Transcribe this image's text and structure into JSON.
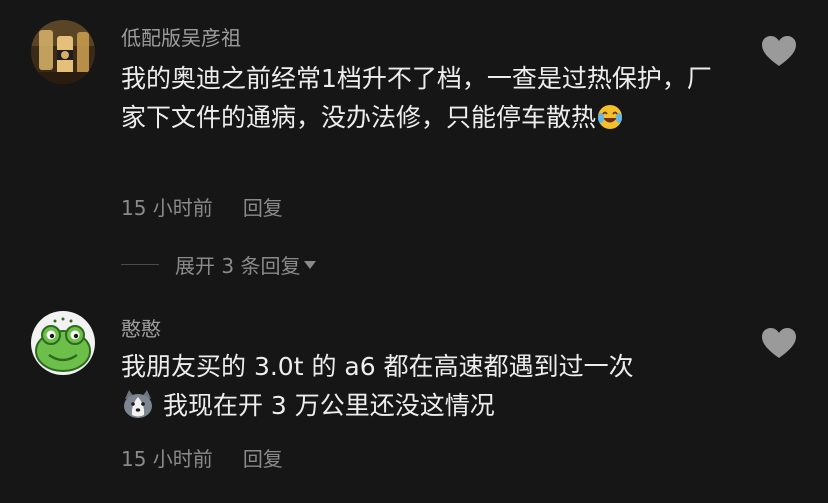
{
  "comments": [
    {
      "username": "低配版吴彦祖",
      "text": "我的奥迪之前经常1档升不了档，一查是过热保护，厂家下文件的通病，没办法修，只能停车散热",
      "time": "15 小时前",
      "reply_label": "回复",
      "avatar_icon": "milk-tea-avatar",
      "trailing_emoji": "laughing-crying-emoji"
    },
    {
      "username": "憨憨",
      "text_line1": "我朋友买的 3.0t 的 a6 都在高速都遇到过一次",
      "text_line2": "我现在开 3 万公里还没这情况",
      "time": "15 小时前",
      "reply_label": "回复",
      "avatar_icon": "green-frog-avatar",
      "leading_emoji": "husky-dog-emoji"
    }
  ],
  "expand": {
    "label": "展开 3 条回复",
    "icon": "caret-down-icon"
  },
  "colors": {
    "background": "#161616",
    "primary_text": "#ededed",
    "secondary_text": "#8a8a8a",
    "heart": "#9a9a9a"
  }
}
